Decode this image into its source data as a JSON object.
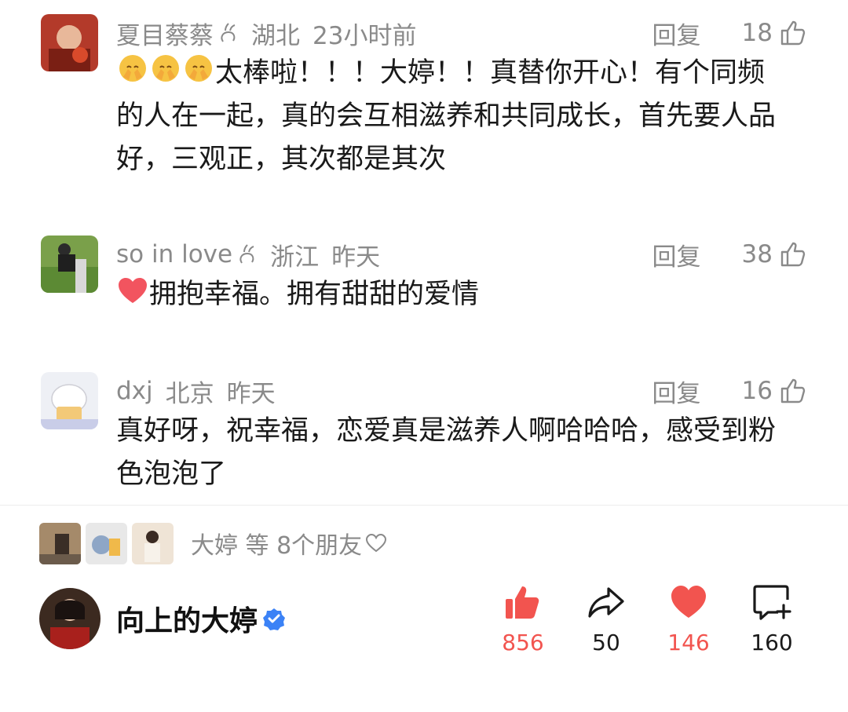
{
  "comments": [
    {
      "username": "夏目蔡蔡",
      "region": "湖北",
      "time": "23小时前",
      "reply_label": "回复",
      "likes": "18",
      "emojis": [
        "pray-hands-emoji",
        "pray-hands-emoji",
        "pray-hands-emoji"
      ],
      "lines": [
        "太棒啦！！！大婷！！真替你开心！有个同频",
        "的人在一起，真的会互相滋养和共同成长，首先要人品",
        "好，三观正，其次都是其次"
      ]
    },
    {
      "username": "so in love",
      "region": "浙江",
      "time": "昨天",
      "reply_label": "回复",
      "likes": "38",
      "emojis": [
        "heart-emoji"
      ],
      "lines": [
        "拥抱幸福。拥有甜甜的爱情"
      ]
    },
    {
      "username": "dxj",
      "region": "北京",
      "time": "昨天",
      "reply_label": "回复",
      "likes": "16",
      "lines": [
        "真好呀，祝幸福，恋爱真是滋养人啊哈哈哈，感受到粉",
        "色泡泡了"
      ]
    }
  ],
  "friends_liked": {
    "text": "大婷 等 8个朋友"
  },
  "author": {
    "name": "向上的大婷"
  },
  "bottom_bar": {
    "like_count": "856",
    "share_count": "50",
    "favorite_count": "146",
    "comment_count": "160"
  },
  "colors": {
    "accent_red": "#f2544f",
    "meta_gray": "#8a8a8a",
    "verified_blue": "#3b82f6"
  }
}
